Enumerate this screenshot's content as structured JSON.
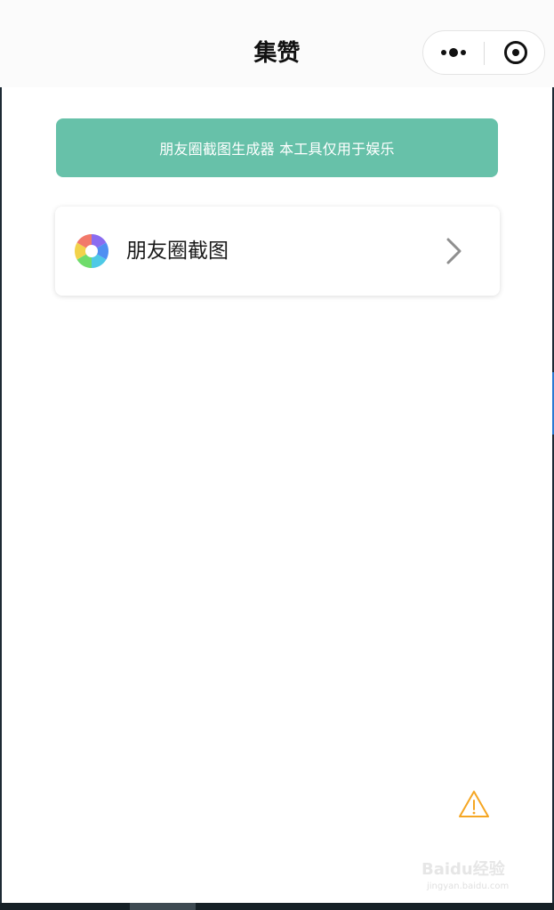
{
  "navbar": {
    "title": "集赞",
    "more_icon": "more-dots-icon",
    "close_icon": "target-close-icon"
  },
  "banner": {
    "text": "朋友圈截图生成器 本工具仅用于娱乐",
    "color": "#67c1a9"
  },
  "menu": {
    "items": [
      {
        "label": "朋友圈截图",
        "icon": "aperture-icon",
        "chevron": "chevron-right-icon"
      }
    ]
  },
  "warning_icon": "warning-triangle-icon",
  "watermark": {
    "main": "Baidu经验",
    "sub": "jingyan.baidu.com"
  }
}
